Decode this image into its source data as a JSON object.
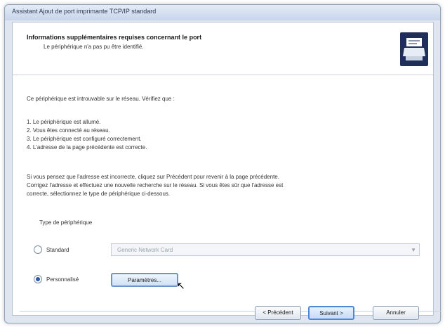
{
  "window": {
    "title": "Assistant Ajout de port imprimante TCP/IP standard"
  },
  "header": {
    "title": "Informations supplémentaires requises concernant le port",
    "subtitle": "Le périphérique n'a pas pu être identifié.",
    "icon": "printer-port-icon"
  },
  "content": {
    "intro": "Ce périphérique est introuvable sur le réseau. Vérifiez que :",
    "checks": [
      "1. Le périphérique est allumé.",
      "2. Vous êtes connecté au réseau.",
      "3. Le périphérique est configuré correctement.",
      "4. L'adresse de la page précédente est correcte."
    ],
    "advice_lines": [
      "Si vous pensez que l'adresse est incorrecte, cliquez sur Précédent pour revenir à la page précédente.",
      "Corrigez l'adresse et effectuez une nouvelle recherche sur le réseau. Si vous êtes sûr que l'adresse est",
      "correcte, sélectionnez le type de périphérique ci-dessous."
    ]
  },
  "device_type": {
    "label": "Type de périphérique",
    "options": [
      {
        "label": "Standard",
        "selected": false
      },
      {
        "label": "Personnalisé",
        "selected": true
      }
    ],
    "standard_select_value": "Generic Network Card",
    "parameters_button": "Paramètres..."
  },
  "footer": {
    "previous": "< Précédent",
    "next": "Suivant >",
    "cancel": "Annuler"
  },
  "colors": {
    "accent": "#2a58a8",
    "header_icon_bg": "#1f2f5a"
  }
}
